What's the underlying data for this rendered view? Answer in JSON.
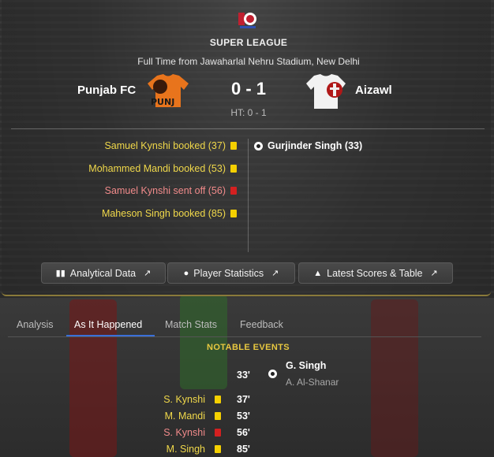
{
  "header": {
    "competition": "SUPER LEAGUE",
    "venue": "Full Time from Jawaharlal Nehru Stadium, New Delhi"
  },
  "match": {
    "home_team": "Punjab FC",
    "away_team": "Aizawl",
    "score": "0 - 1",
    "half_time": "HT: 0 - 1",
    "home_kit_text": "PUNJ"
  },
  "home_events": [
    {
      "text": "Samuel Kynshi booked (37)",
      "card": "yellow"
    },
    {
      "text": "Mohammed Mandi booked (53)",
      "card": "yellow"
    },
    {
      "text": "Samuel Kynshi sent off (56)",
      "card": "red"
    },
    {
      "text": "Maheson Singh booked (85)",
      "card": "yellow"
    }
  ],
  "away_events": [
    {
      "text": "Gurjinder Singh (33)",
      "icon": "football-icon"
    }
  ],
  "buttons": {
    "analytical": "Analytical Data",
    "player_stats": "Player Statistics",
    "latest_scores": "Latest Scores & Table"
  },
  "tabs": [
    "Analysis",
    "As It Happened",
    "Match Stats",
    "Feedback"
  ],
  "active_tab": "As It Happened",
  "notable": {
    "heading": "NOTABLE EVENTS",
    "goal": {
      "minute": "33'",
      "scorer": "G. Singh",
      "assist": "A. Al-Shanar"
    },
    "cards": [
      {
        "name": "S. Kynshi",
        "minute": "37'",
        "card": "yellow"
      },
      {
        "name": "M. Mandi",
        "minute": "53'",
        "card": "yellow"
      },
      {
        "name": "S. Kynshi",
        "minute": "56'",
        "card": "red"
      },
      {
        "name": "M. Singh",
        "minute": "85'",
        "card": "yellow"
      }
    ]
  },
  "colors": {
    "yellow_card": "#f5d000",
    "red_card": "#d42020",
    "event_yellow_text": "#f0d84a",
    "event_red_text": "#f08a8a",
    "notable_heading": "#e8c840",
    "tab_underline": "#3a6fd8"
  }
}
